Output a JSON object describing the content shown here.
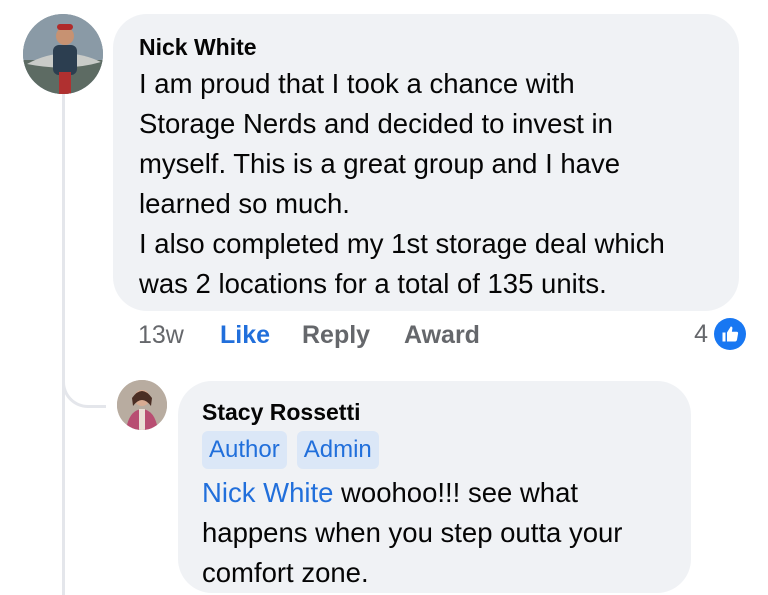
{
  "comment": {
    "author": "Nick White",
    "text": "I am proud that I took a chance with\nStorage Nerds and decided to invest in\nmyself. This is a great group and I have\nlearned so much.\nI also completed my 1st storage deal which\nwas 2 locations for a total of 135 units.",
    "time": "13w",
    "like_label": "Like",
    "reply_label": "Reply",
    "award_label": "Award",
    "reaction_count": "4",
    "reaction_icon": "thumbs-up-icon"
  },
  "reply": {
    "author": "Stacy Rossetti",
    "badges": [
      "Author",
      "Admin"
    ],
    "mention": "Nick White",
    "text": " woohoo!!! see what happens when you step outta your comfort zone."
  },
  "colors": {
    "bubble": "#f0f2f5",
    "link": "#216fdb",
    "badge_bg": "#dbe7f7",
    "like_badge": "#1877f2",
    "muted": "#65676b"
  }
}
